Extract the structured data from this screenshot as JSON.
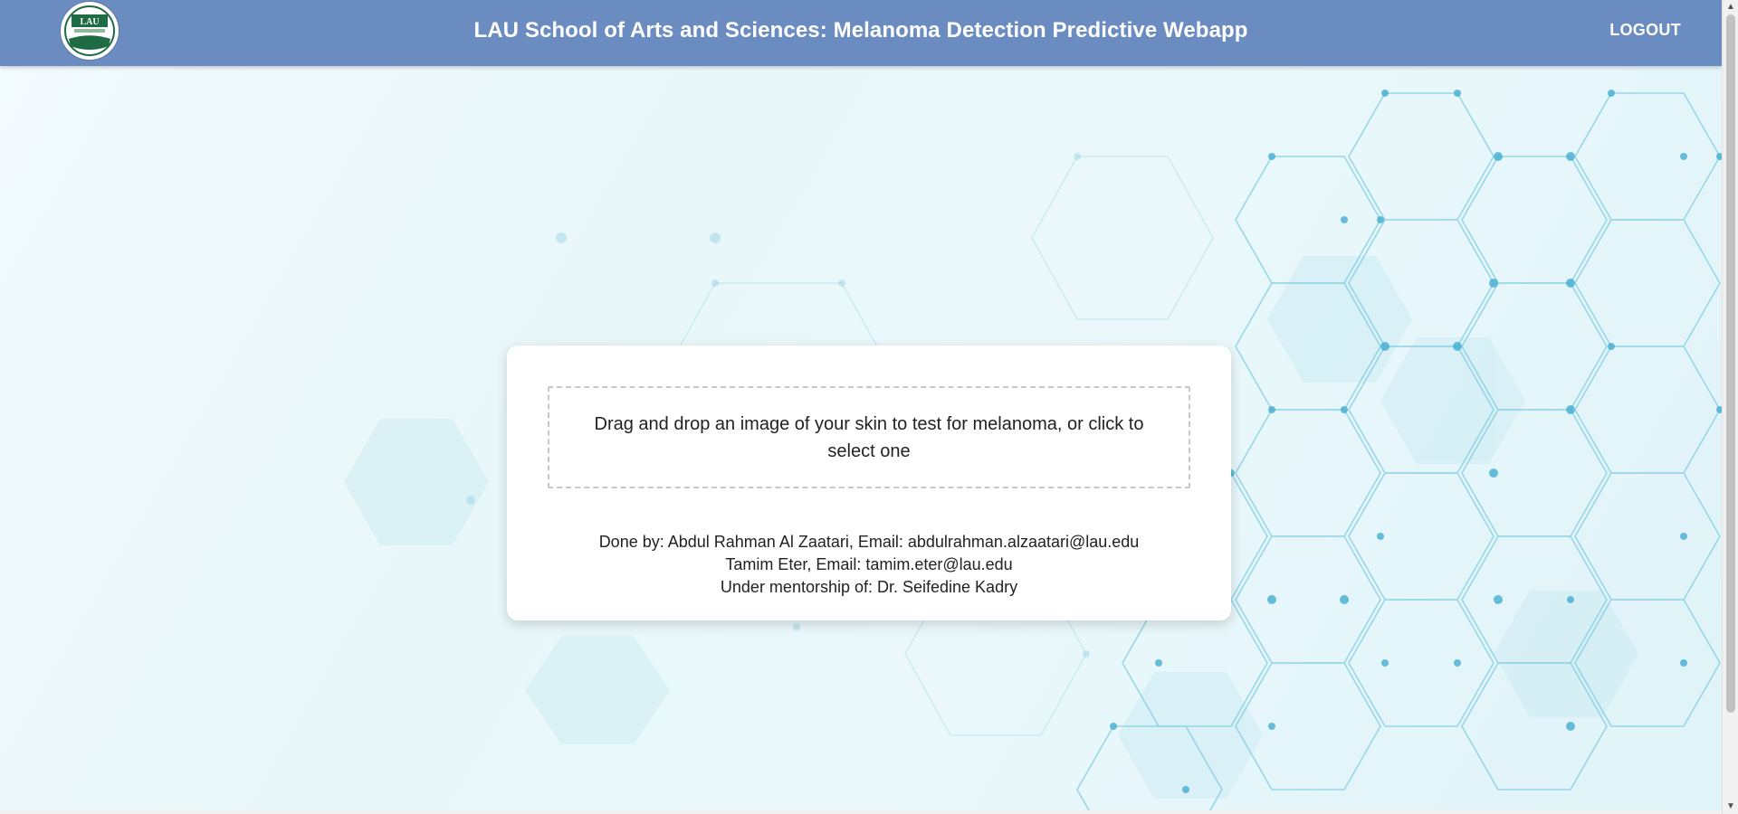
{
  "header": {
    "title": "LAU School of Arts and Sciences: Melanoma Detection Predictive Webapp",
    "logout_label": "LOGOUT",
    "logo_text": "LAU",
    "background_color": "#6b8cc1"
  },
  "upload": {
    "dropzone_text": "Drag and drop an image of your skin to test for melanoma, or click to select one"
  },
  "credits": {
    "line1": "Done by: Abdul Rahman Al Zaatari, Email: abdulrahman.alzaatari@lau.edu",
    "line2": "Tamim Eter, Email: tamim.eter@lau.edu",
    "line3": "Under mentorship of: Dr. Seifedine Kadry"
  },
  "colors": {
    "accent": "#6b8cc1",
    "logo_green": "#1f6b44",
    "hex_pattern": "#4fb6d6"
  },
  "icons": {
    "logo": "lau-seal-icon",
    "scroll_up": "triangle-up-icon",
    "scroll_down": "triangle-down-icon"
  }
}
